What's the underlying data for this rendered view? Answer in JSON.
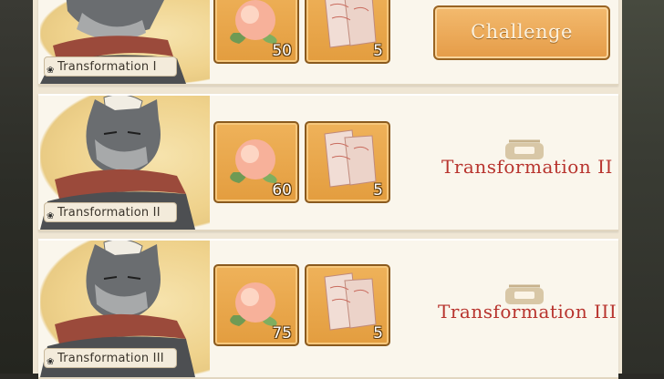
{
  "rows": [
    {
      "name": "Transformation I",
      "items": [
        {
          "icon": "peach-icon",
          "count": "50"
        },
        {
          "icon": "talisman-scroll-icon",
          "count": "5"
        }
      ],
      "action": {
        "type": "button",
        "label": "Challenge"
      }
    },
    {
      "name": "Transformation II",
      "items": [
        {
          "icon": "peach-icon",
          "count": "60"
        },
        {
          "icon": "talisman-scroll-icon",
          "count": "5"
        }
      ],
      "action": {
        "type": "locked",
        "label": "Transformation II",
        "icon": "lock-icon"
      }
    },
    {
      "name": "Transformation III",
      "items": [
        {
          "icon": "peach-icon",
          "count": "75"
        },
        {
          "icon": "talisman-scroll-icon",
          "count": "5"
        }
      ],
      "action": {
        "type": "locked",
        "label": "Transformation III",
        "icon": "lock-icon"
      }
    }
  ],
  "colors": {
    "item_bg": "#e9a74e",
    "locked_text": "#b8342e",
    "button_bg": "#ecac5b"
  }
}
